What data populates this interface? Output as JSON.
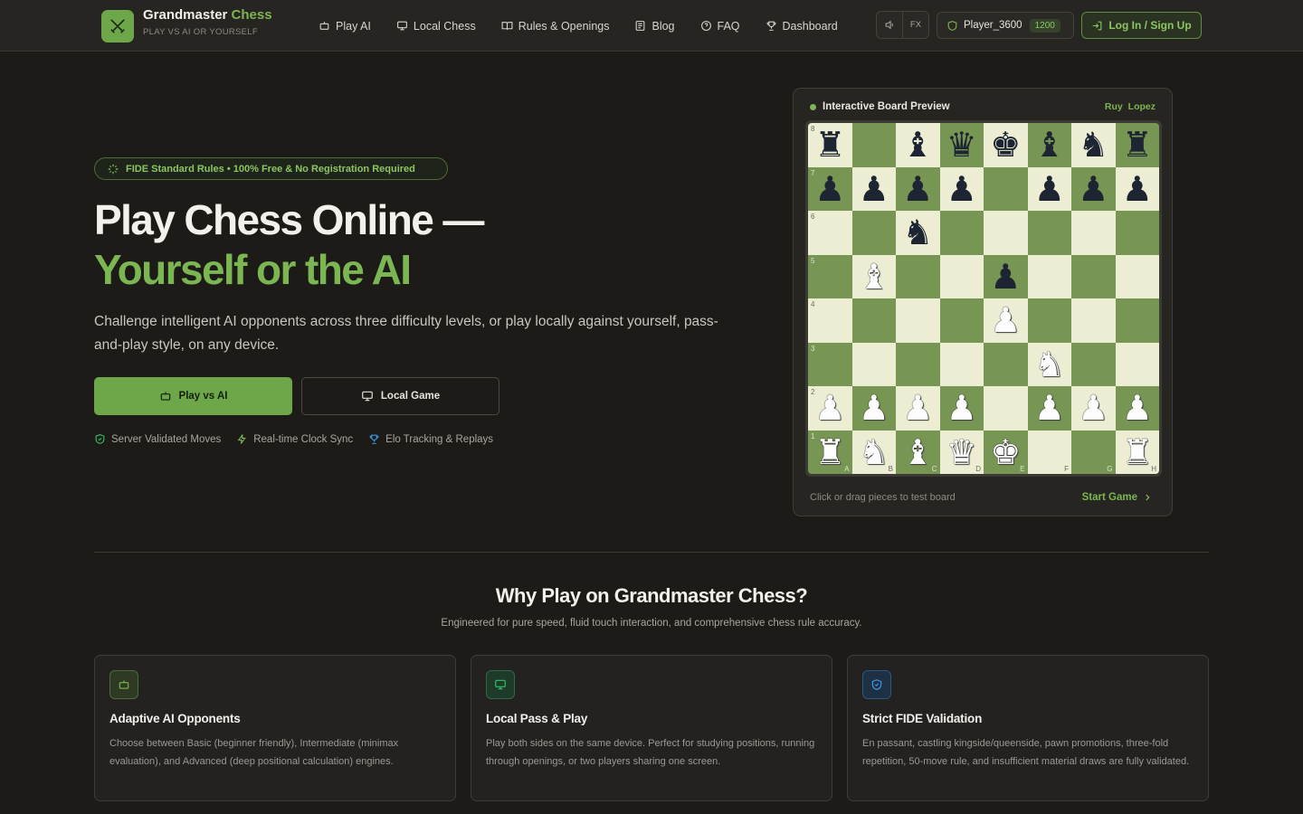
{
  "brand": {
    "name": "Grandmaster",
    "accent": "Chess",
    "tagline": "PLAY VS AI OR YOURSELF"
  },
  "nav": {
    "links": [
      {
        "label": "Play AI",
        "icon": "robot-icon"
      },
      {
        "label": "Local Chess",
        "icon": "monitor-icon"
      },
      {
        "label": "Rules & Openings",
        "icon": "book-icon"
      },
      {
        "label": "Blog",
        "icon": "newspaper-icon"
      },
      {
        "label": "FAQ",
        "icon": "help-circle-icon"
      },
      {
        "label": "Dashboard",
        "icon": "trophy-icon"
      }
    ],
    "fx_label": "FX",
    "player_name": "Player_3600",
    "player_elo": "1200",
    "login_label": "Log In / Sign Up"
  },
  "hero": {
    "badge": "FIDE Standard Rules • 100% Free & No Registration Required",
    "title_line1": "Play Chess Online —",
    "title_line2": "Yourself or the AI",
    "description": "Challenge intelligent AI opponents across three difficulty levels, or play locally against yourself, pass-and-play style, on any device.",
    "primary_button": "Play vs AI",
    "secondary_button": "Local Game",
    "features": [
      "Server Validated Moves",
      "Real-time Clock Sync",
      "Elo Tracking & Replays"
    ]
  },
  "board": {
    "title": "Interactive Board Preview",
    "opening": "Ruy Lopez",
    "hint": "Click or drag pieces to test board",
    "start_label": "Start Game",
    "files": [
      "A",
      "B",
      "C",
      "D",
      "E",
      "F",
      "G",
      "H"
    ],
    "ranks": [
      "8",
      "7",
      "6",
      "5",
      "4",
      "3",
      "2",
      "1"
    ],
    "position": [
      [
        "br",
        "",
        "bb",
        "bq",
        "bk",
        "bb",
        "bn",
        "br"
      ],
      [
        "bp",
        "bp",
        "bp",
        "bp",
        "",
        "bp",
        "bp",
        "bp"
      ],
      [
        "",
        "",
        "bn",
        "",
        "",
        "",
        "",
        ""
      ],
      [
        "",
        "wb",
        "",
        "",
        "bp",
        "",
        "",
        ""
      ],
      [
        "",
        "",
        "",
        "",
        "wp",
        "",
        "",
        ""
      ],
      [
        "",
        "",
        "",
        "",
        "",
        "wn",
        "",
        ""
      ],
      [
        "wp",
        "wp",
        "wp",
        "wp",
        "",
        "wp",
        "wp",
        "wp"
      ],
      [
        "wr",
        "wn",
        "wb",
        "wq",
        "wk",
        "",
        "",
        "wr"
      ]
    ]
  },
  "why": {
    "title": "Why Play on Grandmaster Chess?",
    "subtitle": "Engineered for pure speed, fluid touch interaction, and comprehensive chess rule accuracy.",
    "cards": [
      {
        "title": "Adaptive AI Opponents",
        "description": "Choose between Basic (beginner friendly), Intermediate (minimax evaluation), and Advanced (deep positional calculation) engines.",
        "icon": "robot-icon",
        "color": "#7cb652"
      },
      {
        "title": "Local Pass & Play",
        "description": "Play both sides on the same device. Perfect for studying positions, running through openings, or two players sharing one screen.",
        "icon": "monitor-icon",
        "color": "#34c26b"
      },
      {
        "title": "Strict FIDE Validation",
        "description": "En passant, castling kingside/queenside, pawn promotions, three-fold repetition, 50-move rule, and insufficient material draws are fully validated.",
        "icon": "shield-check-icon",
        "color": "#3b9ae6"
      }
    ]
  },
  "colors": {
    "accent": "#7cb652",
    "background": "#1c1b18",
    "board_light": "#ecedd3",
    "board_dark": "#779553"
  }
}
